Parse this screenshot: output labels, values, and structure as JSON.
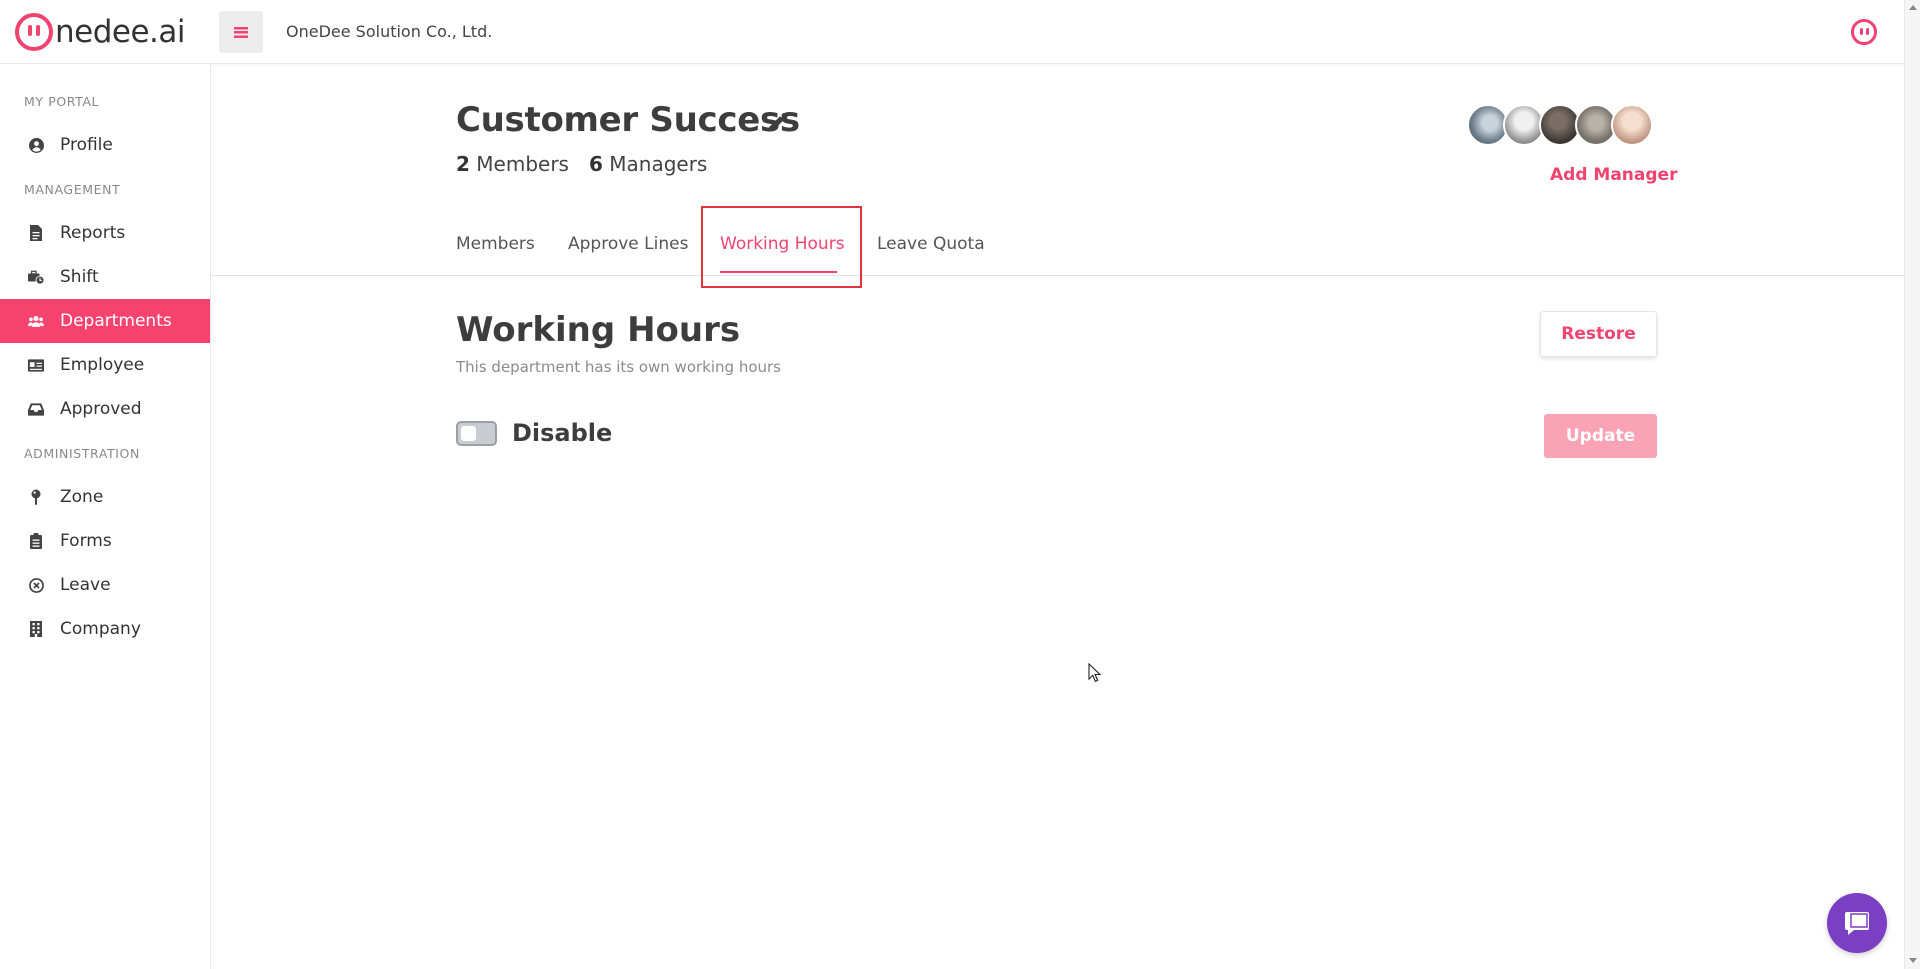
{
  "brand": {
    "logo_text": "nedee.ai",
    "company_name": "OneDee Solution Co., Ltd.",
    "accent_color": "#f0436f"
  },
  "sidebar": {
    "sections": [
      {
        "title": "MY PORTAL"
      },
      {
        "title": "MANAGEMENT"
      },
      {
        "title": "ADMINISTRATION"
      }
    ],
    "items": [
      {
        "label": "Profile",
        "icon": "user-circle-icon"
      },
      {
        "label": "Reports",
        "icon": "file-icon"
      },
      {
        "label": "Shift",
        "icon": "briefcase-clock-icon"
      },
      {
        "label": "Departments",
        "icon": "users-icon",
        "active": true
      },
      {
        "label": "Employee",
        "icon": "id-card-icon"
      },
      {
        "label": "Approved",
        "icon": "inbox-icon"
      },
      {
        "label": "Zone",
        "icon": "map-pin-icon"
      },
      {
        "label": "Forms",
        "icon": "clipboard-icon"
      },
      {
        "label": "Leave",
        "icon": "x-circle-icon"
      },
      {
        "label": "Company",
        "icon": "building-icon"
      }
    ]
  },
  "department": {
    "name": "Customer Success",
    "members_count": "2",
    "members_label": "Members",
    "managers_count": "6",
    "managers_label": "Managers",
    "add_manager_label": "Add Manager"
  },
  "tabs": [
    {
      "label": "Members"
    },
    {
      "label": "Approve Lines"
    },
    {
      "label": "Working Hours",
      "active": true
    },
    {
      "label": "Leave Quota"
    }
  ],
  "working_hours": {
    "title": "Working Hours",
    "subtitle": "This department has its own working hours",
    "restore_label": "Restore",
    "toggle_label": "Disable",
    "toggle_on": false,
    "update_label": "Update"
  }
}
